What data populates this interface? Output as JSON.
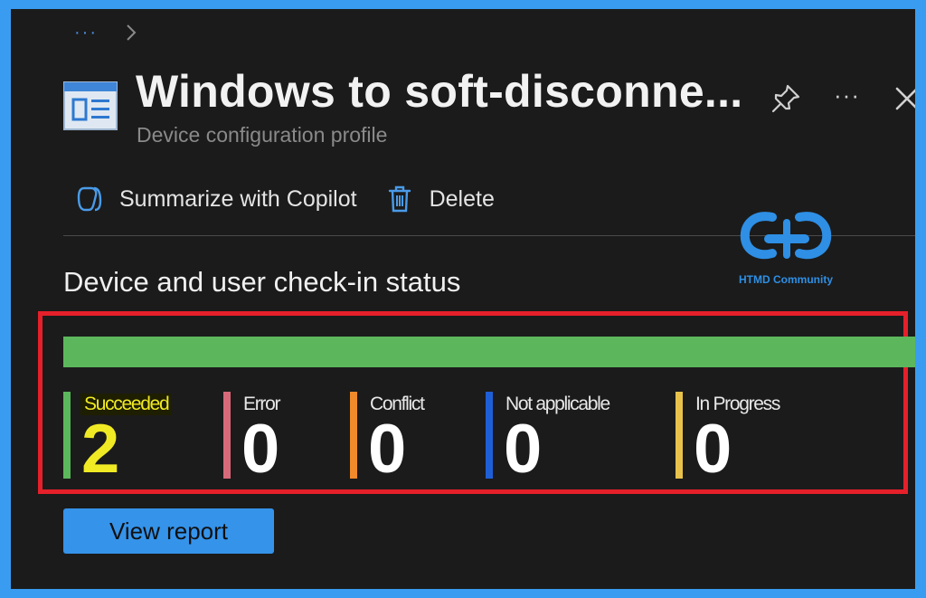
{
  "breadcrumb": {
    "ellipsis": "···"
  },
  "header": {
    "title": "Windows to soft-disconne...",
    "subtitle": "Device configuration profile",
    "icons": {
      "profile": "profile-document-icon",
      "pin": "pin-icon",
      "more": "ellipsis-icon",
      "close": "close-icon"
    },
    "more_label": "···"
  },
  "toolbar": {
    "copilot_label": "Summarize with Copilot",
    "copilot_icon": "copilot-icon",
    "delete_label": "Delete",
    "delete_icon": "trash-icon"
  },
  "watermark": {
    "text": "HTMD Community",
    "icon": "htmd-logo"
  },
  "status_section": {
    "title": "Device and user check-in status",
    "bar": {
      "succeeded_fraction": 1.0,
      "color": "#5cb75c"
    },
    "stats": [
      {
        "label": "Succeeded",
        "value": "2",
        "color": "#5cb75c"
      },
      {
        "label": "Error",
        "value": "0",
        "color": "#d76a7a"
      },
      {
        "label": "Conflict",
        "value": "0",
        "color": "#f08a2a"
      },
      {
        "label": "Not applicable",
        "value": "0",
        "color": "#1f5fd6"
      },
      {
        "label": "In Progress",
        "value": "0",
        "color": "#e8c24a"
      }
    ]
  },
  "actions": {
    "view_report_label": "View report"
  },
  "colors": {
    "accent": "#3593ea",
    "highlight_border": "#e5202a",
    "panel_bg": "#1b1b1b"
  }
}
